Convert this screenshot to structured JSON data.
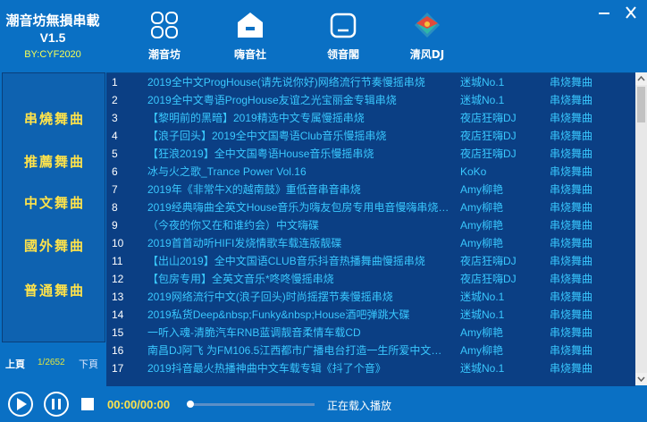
{
  "app": {
    "title": "潮音坊無損串載",
    "version": "V1.5",
    "author": "BY:CYF2020"
  },
  "nav": [
    {
      "label": "潮音坊",
      "icon": "grid-icon"
    },
    {
      "label": "嗨音社",
      "icon": "house-icon"
    },
    {
      "label": "领音閣",
      "icon": "box-icon"
    },
    {
      "label": "清风DJ",
      "icon": "dj-logo-icon"
    }
  ],
  "sidebar": {
    "categories": [
      "串燒舞曲",
      "推薦舞曲",
      "中文舞曲",
      "國外舞曲",
      "普通舞曲"
    ],
    "pager": {
      "prev": "上頁",
      "info": "1/2652",
      "next": "下頁"
    }
  },
  "songs": [
    {
      "n": "1",
      "title": "2019全中文ProgHouse(请先说你好)网络流行节奏慢摇串烧",
      "artist": "迷城No.1",
      "genre": "串烧舞曲"
    },
    {
      "n": "2",
      "title": "2019全中文粤语ProgHouse友谊之光宝丽金专辑串烧",
      "artist": "迷城No.1",
      "genre": "串烧舞曲"
    },
    {
      "n": "3",
      "title": "【黎明前的黑暗】2019精选中文专属慢摇串烧",
      "artist": "夜店狂嗨DJ",
      "genre": "串烧舞曲"
    },
    {
      "n": "4",
      "title": "【浪子回头】2019全中文国粤语Club音乐慢摇串烧",
      "artist": "夜店狂嗨DJ",
      "genre": "串烧舞曲"
    },
    {
      "n": "5",
      "title": "【狂浪2019】全中文国粤语House音乐慢摇串烧",
      "artist": "夜店狂嗨DJ",
      "genre": "串烧舞曲"
    },
    {
      "n": "6",
      "title": "冰与火之歌_Trance Power Vol.16",
      "artist": "KoKo",
      "genre": "串烧舞曲"
    },
    {
      "n": "7",
      "title": "2019年《非常牛X的越南鼓》重低音串音串烧",
      "artist": "Amy柳艳",
      "genre": "串烧舞曲"
    },
    {
      "n": "8",
      "title": "2019经典嗨曲全英文House音乐为嗨友包房专用电音慢嗨串烧…",
      "artist": "Amy柳艳",
      "genre": "串烧舞曲"
    },
    {
      "n": "9",
      "title": "（今夜的你又在和谁约会）中文嗨碟",
      "artist": "Amy柳艳",
      "genre": "串烧舞曲"
    },
    {
      "n": "10",
      "title": "2019首首动听HIFI发烧情歌车载连版靓碟",
      "artist": "Amy柳艳",
      "genre": "串烧舞曲"
    },
    {
      "n": "11",
      "title": "【出山2019】全中文国语CLUB音乐抖音热播舞曲慢摇串烧",
      "artist": "夜店狂嗨DJ",
      "genre": "串烧舞曲"
    },
    {
      "n": "12",
      "title": "【包房专用】全英文音乐*咚咚慢摇串烧",
      "artist": "夜店狂嗨DJ",
      "genre": "串烧舞曲"
    },
    {
      "n": "13",
      "title": "2019网络流行中文(浪子回头)时尚摇摆节奏慢摇串烧",
      "artist": "迷城No.1",
      "genre": "串烧舞曲"
    },
    {
      "n": "14",
      "title": "2019私货Deep&nbsp;Funky&nbsp;House酒吧弹跳大碟",
      "artist": "迷城No.1",
      "genre": "串烧舞曲"
    },
    {
      "n": "15",
      "title": "一听入魂-清脆汽车RNB蓝调靓音柔情车载CD",
      "artist": "Amy柳艳",
      "genre": "串烧舞曲"
    },
    {
      "n": "16",
      "title": "南昌DJ阿飞 为FM106.5江西都市广播电台打造一生所爱中文…",
      "artist": "Amy柳艳",
      "genre": "串烧舞曲"
    },
    {
      "n": "17",
      "title": "2019抖音最火热播神曲中文车载专辑《抖了个音》",
      "artist": "迷城No.1",
      "genre": "串烧舞曲"
    }
  ],
  "player": {
    "time": "00:00/00:00",
    "status": "正在载入播放",
    "progress": 0
  },
  "colors": {
    "background": "#0a70c4",
    "list_background": "#0b3f84",
    "song_text": "#39c8ff",
    "category_text": "#ffe34a",
    "author_text": "#f6ff55"
  }
}
